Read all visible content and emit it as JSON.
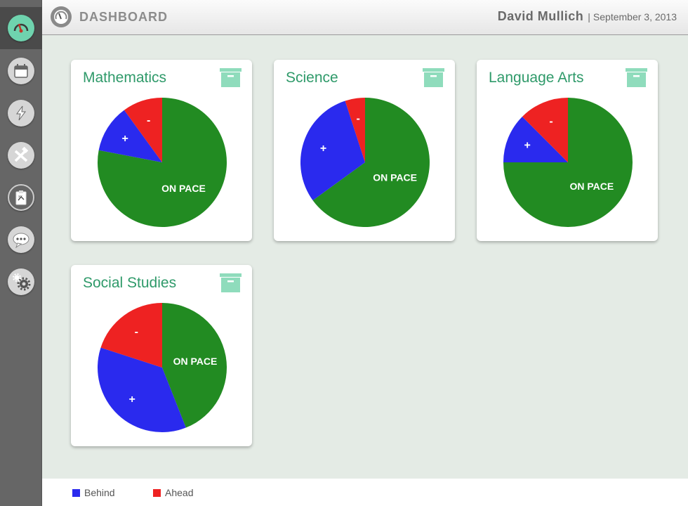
{
  "header": {
    "title": "DASHBOARD",
    "user_name": "David Mullich",
    "separator": "|",
    "date": "September 3, 2013"
  },
  "sidebar": {
    "items": [
      {
        "icon": "gauge-icon",
        "active": true
      },
      {
        "icon": "calendar-icon"
      },
      {
        "icon": "lightning-icon"
      },
      {
        "icon": "tools-icon"
      },
      {
        "icon": "clipboard-icon"
      },
      {
        "icon": "chat-icon"
      },
      {
        "icon": "gears-icon"
      }
    ]
  },
  "colors": {
    "on_pace": "#228b22",
    "behind": "#2a2aee",
    "ahead": "#ee2222",
    "accent": "#6fd3ae",
    "title": "#2f9a6a"
  },
  "chart_data": [
    {
      "type": "pie",
      "title": "Mathematics",
      "slices": [
        {
          "label": "ON PACE",
          "value": 78,
          "series": "on_pace"
        },
        {
          "label": "+",
          "value": 12,
          "series": "behind"
        },
        {
          "label": "-",
          "value": 10,
          "series": "ahead"
        }
      ]
    },
    {
      "type": "pie",
      "title": "Science",
      "slices": [
        {
          "label": "ON PACE",
          "value": 65,
          "series": "on_pace"
        },
        {
          "label": "+",
          "value": 30,
          "series": "behind"
        },
        {
          "label": "-",
          "value": 5,
          "series": "ahead"
        }
      ]
    },
    {
      "type": "pie",
      "title": "Language Arts",
      "slices": [
        {
          "label": "ON PACE",
          "value": 75,
          "series": "on_pace"
        },
        {
          "label": "+",
          "value": 12.5,
          "series": "behind"
        },
        {
          "label": "-",
          "value": 12.5,
          "series": "ahead"
        }
      ]
    },
    {
      "type": "pie",
      "title": "Social Studies",
      "slices": [
        {
          "label": "ON PACE",
          "value": 44,
          "series": "on_pace"
        },
        {
          "label": "+",
          "value": 36,
          "series": "behind"
        },
        {
          "label": "-",
          "value": 20,
          "series": "ahead"
        }
      ]
    }
  ],
  "legend": {
    "behind_label": "Behind",
    "ahead_label": "Ahead",
    "placement": "bottom-left"
  }
}
